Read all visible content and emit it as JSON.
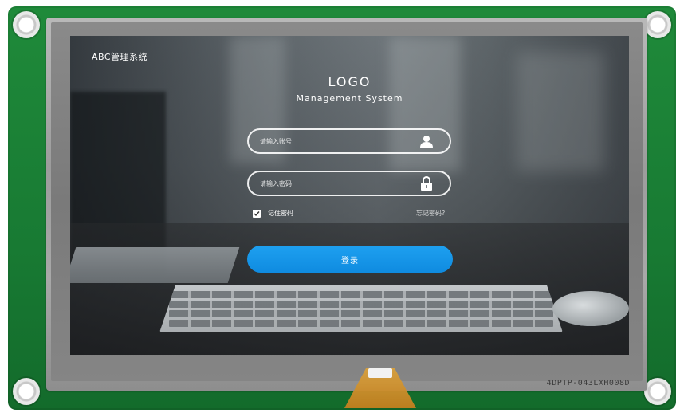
{
  "app": {
    "title": "ABC管理系统",
    "logo": "LOGO",
    "subtitle": "Management System"
  },
  "login_form": {
    "username": {
      "placeholder": "请输入账号",
      "value": "",
      "icon": "user-icon"
    },
    "password": {
      "placeholder": "请输入密码",
      "value": "",
      "icon": "lock-icon"
    },
    "remember_me": {
      "label": "记住密码",
      "checked": true
    },
    "forgot_password": "忘记密码?",
    "submit_label": "登录"
  },
  "hardware": {
    "marking": "4DPTP-043LXH008D"
  },
  "colors": {
    "primary_button": "#1497EA",
    "pcb_green": "#1b8236",
    "text": "#ffffff"
  }
}
